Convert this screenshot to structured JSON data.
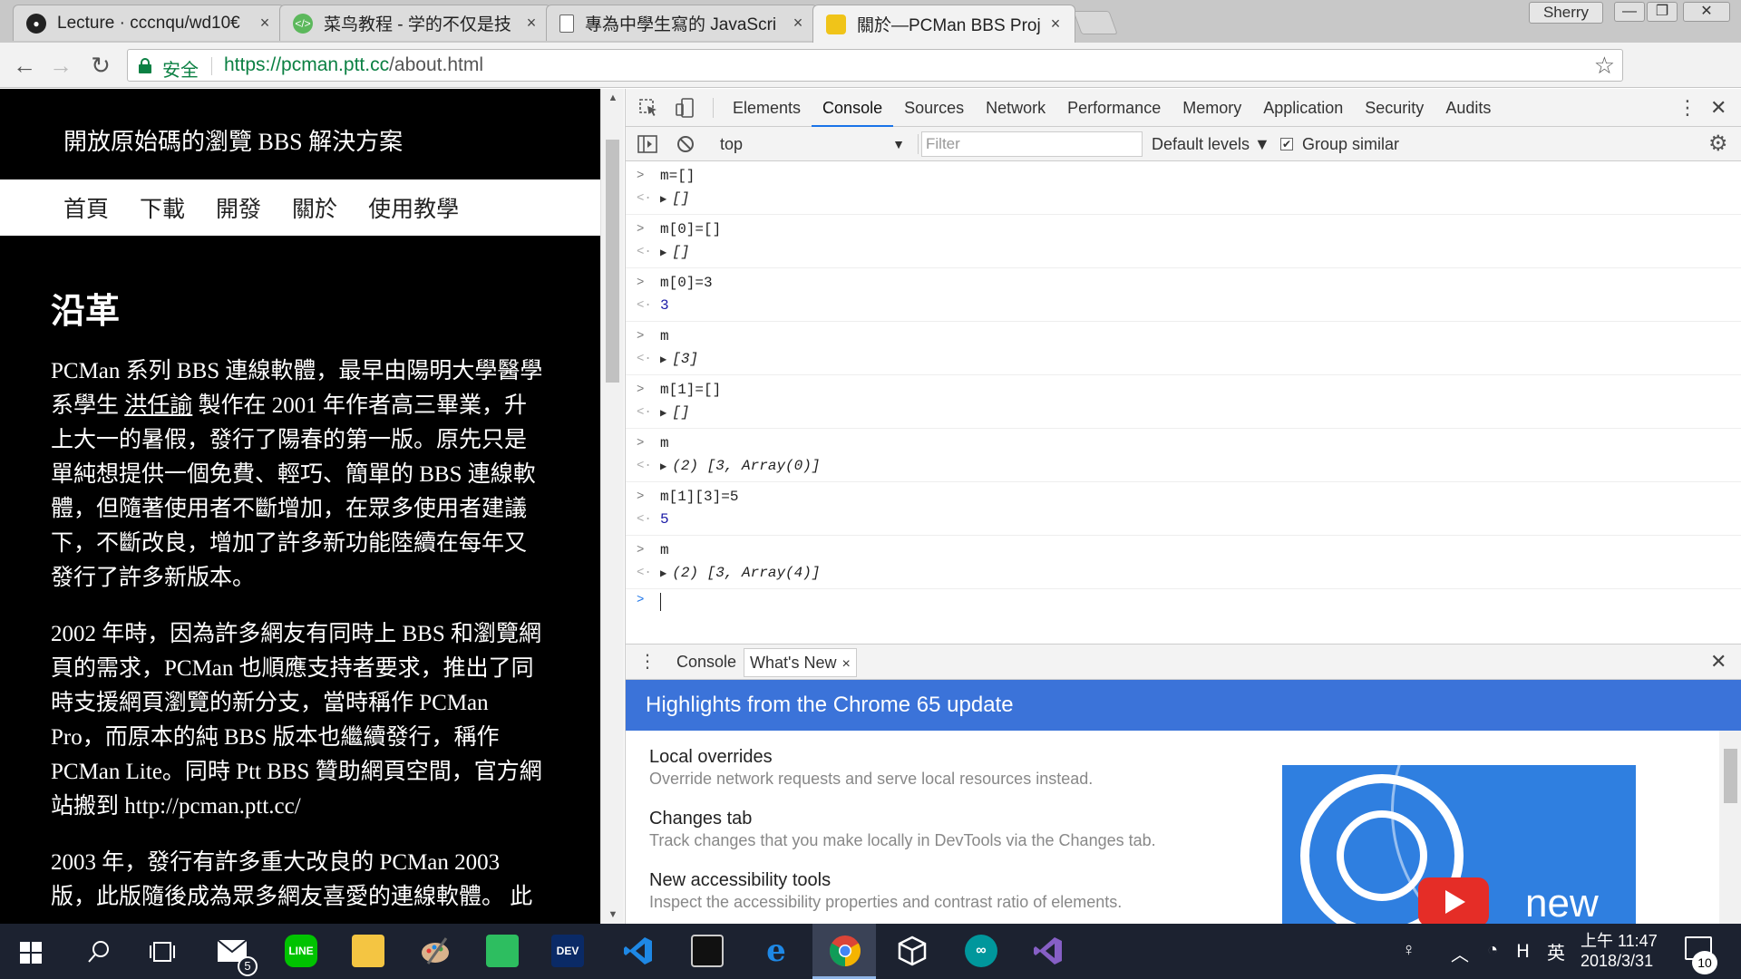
{
  "browser": {
    "tabs": [
      {
        "title": "Lecture · cccnqu/wd10€",
        "icon": "github-icon"
      },
      {
        "title": "菜鸟教程 - 学的不仅是技",
        "icon": "runoob-icon"
      },
      {
        "title": "專為中學生寫的 JavaScri",
        "icon": "document-icon"
      },
      {
        "title": "關於—PCMan BBS Proj",
        "icon": "pcman-icon",
        "active": true
      }
    ],
    "close_glyph": "×",
    "profile_name": "Sherry",
    "window_controls": {
      "minimize": "—",
      "restore": "❐",
      "close": "✕"
    },
    "nav": {
      "back": "←",
      "forward": "→",
      "reload": "↻"
    },
    "secure_label": "安全",
    "url_scheme_host": "https://pcman.ptt.cc",
    "url_path": "/about.html",
    "star": "☆",
    "menu": "⋮"
  },
  "page": {
    "slogan": "開放原始碼的瀏覽 BBS 解決方案",
    "nav": [
      "首頁",
      "下載",
      "開發",
      "關於",
      "使用教學"
    ],
    "heading": "沿革",
    "paragraphs": [
      {
        "before": "PCMan 系列 BBS 連線軟體，最早由陽明大學醫學系學生 ",
        "link": "洪任諭",
        "after": " 製作在 2001 年作者高三畢業，升上大一的暑假，發行了陽春的第一版。原先只是單純想提供一個免費、輕巧、簡單的 BBS 連線軟體，但隨著使用者不斷增加，在眾多使用者建議下，不斷改良，增加了許多新功能陸續在每年又發行了許多新版本。"
      },
      {
        "before": "2002 年時，因為許多網友有同時上 BBS 和瀏覽網頁的需求，PCMan 也順應支持者要求，推出了同時支援網頁瀏覽的新分支，當時稱作 PCMan Pro，而原本的純 BBS 版本也繼續發行，稱作 PCMan Lite。同時 Ptt BBS 贊助網頁空間，官方網站搬到 http://pcman.ptt.cc/",
        "link": "",
        "after": ""
      },
      {
        "before": "2003 年，發行有許多重大改良的 PCMan 2003 版，此版隨後成為眾多網友喜愛的連線軟體。 此",
        "link": "",
        "after": ""
      }
    ],
    "scroll_up": "▲",
    "scroll_down": "▼"
  },
  "devtools": {
    "tabs": [
      "Elements",
      "Console",
      "Sources",
      "Network",
      "Performance",
      "Memory",
      "Application",
      "Security",
      "Audits"
    ],
    "active_tab": "Console",
    "kebab": "⋮",
    "close": "✕",
    "context": "top",
    "context_arrow": "▼",
    "filter_placeholder": "Filter",
    "levels": "Default levels ▼",
    "group_similar": "Group similar",
    "group_check": "✔",
    "gear": "⚙",
    "input_prompt": ">",
    "result_prompt": "<·",
    "expand": "▶",
    "console": [
      {
        "input": "m=[]",
        "result": "[]",
        "kind": "object"
      },
      {
        "input": "m[0]=[]",
        "result": "[]",
        "kind": "object"
      },
      {
        "input": "m[0]=3",
        "result": "3",
        "kind": "number"
      },
      {
        "input": "m",
        "result": "[3]",
        "kind": "object"
      },
      {
        "input": "m[1]=[]",
        "result": "[]",
        "kind": "object"
      },
      {
        "input": "m",
        "result": "(2) [3, Array(0)]",
        "kind": "object"
      },
      {
        "input": "m[1][3]=5",
        "result": "5",
        "kind": "number"
      },
      {
        "input": "m",
        "result": "(2) [3, Array(4)]",
        "kind": "object"
      }
    ],
    "drawer": {
      "tab_console": "Console",
      "tab_whatsnew": "What's New",
      "tab_close": "×",
      "kebab": "⋮",
      "close": "✕",
      "banner": "Highlights from the Chrome 65 update",
      "items": [
        {
          "title": "Local overrides",
          "desc": "Override network requests and serve local resources instead."
        },
        {
          "title": "Changes tab",
          "desc": "Track changes that you make locally in DevTools via the Changes tab."
        },
        {
          "title": "New accessibility tools",
          "desc": "Inspect the accessibility properties and contrast ratio of elements."
        }
      ],
      "image_label": "new"
    }
  },
  "taskbar": {
    "mail_badge": "5",
    "dev_label": "DEV",
    "ime": "英",
    "time": "上午 11:47",
    "date": "2018/3/31",
    "notification_count": "10",
    "tray_glyphs": {
      "person": "♀",
      "chevron": "︿",
      "wifi": "◔",
      "volume": "ᕼ"
    }
  }
}
